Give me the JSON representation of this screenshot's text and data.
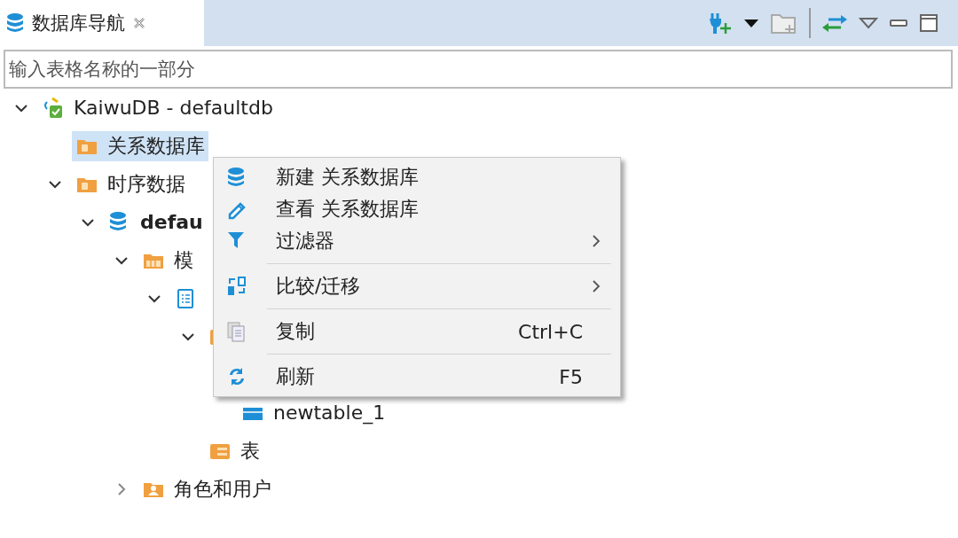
{
  "tab": {
    "title": "数据库导航",
    "closable": true
  },
  "search": {
    "placeholder": "输入表格名称的一部分"
  },
  "tree": [
    {
      "kind": "connection",
      "label": "KaiwuDB - defaultdb",
      "expanded": true,
      "selected": false,
      "children": [
        {
          "kind": "folder",
          "label": "关系数据库",
          "selected": true
        },
        {
          "kind": "folder",
          "label": "时序数据",
          "expanded": true,
          "selected": false,
          "children": [
            {
              "kind": "database",
              "label": "defau",
              "bold": true,
              "expanded": true,
              "selected": false,
              "children": [
                {
                  "kind": "schema-folder",
                  "label": "模",
                  "expanded": true,
                  "selected": false,
                  "children": [
                    {
                      "kind": "schema",
                      "expanded": true,
                      "selected": false,
                      "children": [
                        {
                          "kind": "table-folder",
                          "expanded": true,
                          "selected": false,
                          "children": [
                            {
                              "kind": "table",
                              "label": "newtable_1",
                              "selected": false
                            }
                          ]
                        },
                        {
                          "kind": "table-folder",
                          "label": "表",
                          "selected": false
                        }
                      ]
                    }
                  ]
                },
                {
                  "kind": "user-folder",
                  "label": "角色和用户",
                  "expanded": false,
                  "selected": false
                }
              ]
            }
          ]
        }
      ]
    }
  ],
  "menu": [
    {
      "kind": "database",
      "label": "新建 关系数据库"
    },
    {
      "kind": "pencil",
      "label": "查看 关系数据库"
    },
    {
      "kind": "filter",
      "label": "过滤器",
      "submenu": true
    },
    {
      "kind": "compare",
      "label": "比较/迁移",
      "submenu": true,
      "separator_before": true
    },
    {
      "kind": "copy",
      "label": "复制",
      "shortcut": "Ctrl+C",
      "separator_before": true
    },
    {
      "kind": "refresh",
      "label": "刷新",
      "shortcut": "F5",
      "separator_before": true
    }
  ]
}
